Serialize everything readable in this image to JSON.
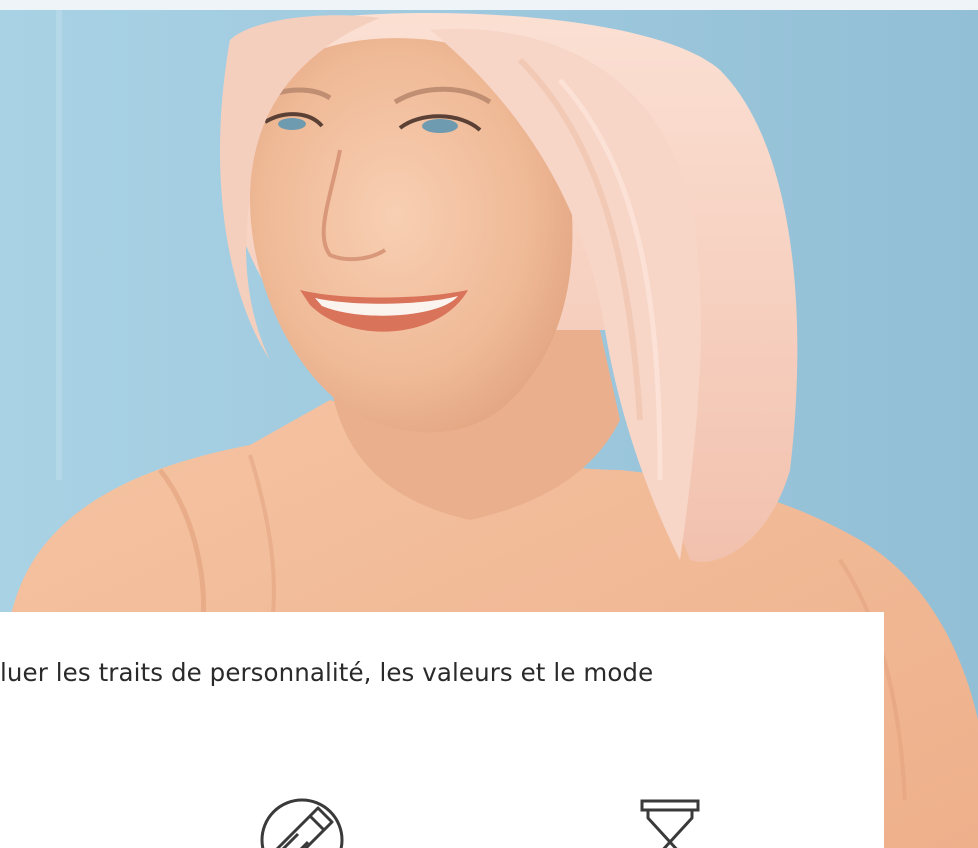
{
  "hero": {
    "image": "smiling-woman-photo",
    "colors": {
      "background": "#9fc9de",
      "skin": "#f3c3a4",
      "hair": "#f6d3c4",
      "blouse": "#f3bc98"
    }
  },
  "card": {
    "text": "luer les traits de personnalité, les valeurs et le mode",
    "icons": [
      "pen-nib-icon",
      "hourglass-icon"
    ]
  }
}
